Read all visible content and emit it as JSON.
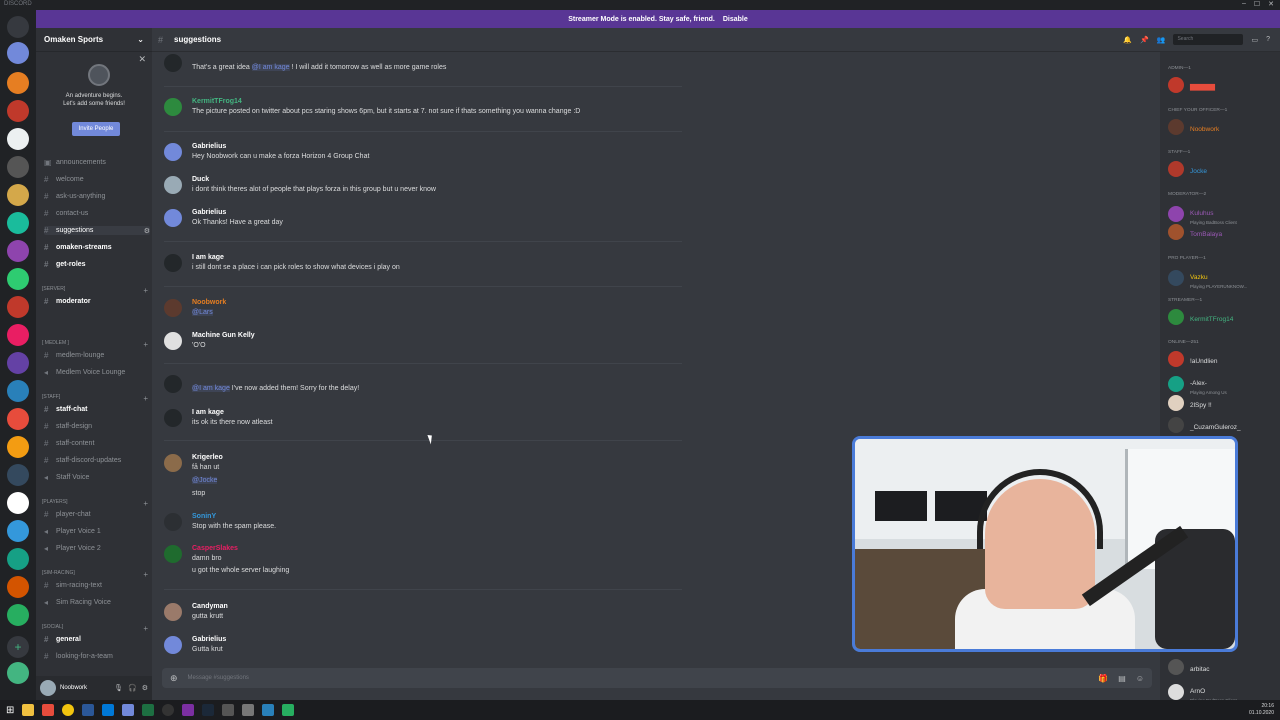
{
  "window": {
    "app_name": "DISCORD",
    "controls": [
      "–",
      "☐",
      "✕"
    ]
  },
  "banner": {
    "text": "Streamer Mode is enabled. Stay safe, friend.",
    "action": "Disable"
  },
  "server": {
    "name": "Omaken Sports",
    "invite": {
      "line1": "An adventure begins.",
      "line2": "Let's add some friends!",
      "button": "Invite People"
    }
  },
  "channel_list": {
    "channels": [
      {
        "label": "announcements"
      },
      {
        "label": "welcome"
      },
      {
        "label": "ask-us-anything"
      },
      {
        "label": "contact-us"
      },
      {
        "label": "suggestions"
      },
      {
        "label": "omaken-streams"
      },
      {
        "label": "get-roles"
      }
    ],
    "cat_server": "[SERVER]",
    "moderator": "moderator",
    "cat_medlem": "[ MEDLEM ]",
    "medlem_lounge": "medlem-lounge",
    "medlem_voice": "Medlem Voice Lounge",
    "cat_staff": "[STAFF]",
    "staff": [
      "staff-chat",
      "staff-design",
      "staff-content",
      "staff-discord-updates",
      "Staff Voice"
    ],
    "cat_players": "[PLAYERS]",
    "players": [
      "player-chat",
      "Player Voice 1",
      "Player Voice 2"
    ],
    "cat_sim": "[SIM-RACING]",
    "sim": [
      "sim-racing-text",
      "Sim Racing Voice"
    ],
    "cat_social": "[SOCIAL]",
    "social": [
      "general",
      "looking-for-a-team"
    ]
  },
  "user_panel": {
    "username": "Noobwork"
  },
  "chat": {
    "channel": "suggestions",
    "search_placeholder": "Search",
    "composer_placeholder": "Message #suggestions",
    "messages": [
      {
        "name": "",
        "line": "That's a great idea",
        "mention": "@I am kage",
        "rest": " ! I will add it tomorrow as well as more game roles"
      },
      {
        "name": "KermitTFrog14",
        "line": "The picture posted on twitter about pcs staring shows 6pm, but it starts at 7. not sure if thats something you wanna change :D"
      },
      {
        "name": "Gabrielius",
        "line": "Hey Noobwork can u make a forza Horizon 4 Group Chat"
      },
      {
        "name": "Duck",
        "line": "i dont think theres alot of people that plays forza in this group but u never know"
      },
      {
        "name": "Gabrielius",
        "line": "Ok Thanks! Have a great day"
      },
      {
        "name": "I am kage",
        "line": "i still dont se a place i can pick roles to show what devices i play on"
      },
      {
        "name": "Noobwork",
        "mention": "@Lars"
      },
      {
        "name": "Machine Gun Kelly",
        "line": "'O'O"
      },
      {
        "name": "",
        "mention": "@I am kage",
        "line": " I've now added them! Sorry for the delay!"
      },
      {
        "name": "I am kage",
        "line": "its ok its there now atleast"
      },
      {
        "name": "Krigerleo",
        "line": "få han ut",
        "mention": "@Jocke",
        "line2": "stop"
      },
      {
        "name": "SoninY",
        "line": "Stop with the spam please."
      },
      {
        "name": "CasperSlakes",
        "line": "damn bro",
        "line2": "u got the whole server laughing"
      },
      {
        "name": "Candyman",
        "line": "gutta krutt"
      },
      {
        "name": "Gabrielius",
        "line": "Gutta krut"
      }
    ]
  },
  "members": {
    "roles": [
      "ADMIN—1",
      "CHIEF YOUR OFFICER—1",
      "STAFF—1",
      "MODERATOR—2",
      "PRO PLAYER—1",
      "STREAMER—1",
      "ONLINE—251"
    ],
    "list": [
      {
        "name": "Noobwork",
        "status": ""
      },
      {
        "name": "Jocke",
        "status": ""
      },
      {
        "name": "Kuluhus",
        "status": "Playing BadBoss Client"
      },
      {
        "name": "TomBalaya",
        "status": ""
      },
      {
        "name": "Vazku",
        "status": "Playing PLAYERUNKNOW..."
      },
      {
        "name": "KermitTFrog14",
        "status": ""
      },
      {
        "name": "!aUndlien",
        "status": ""
      },
      {
        "name": "-Alex-",
        "status": "Playing Among Us"
      },
      {
        "name": "2lSpy !!",
        "status": ""
      },
      {
        "name": "_CuzamGuleroz_",
        "status": ""
      },
      {
        "name": "arbitac",
        "status": ""
      },
      {
        "name": "ArnO",
        "status": "Playing BadBoss Client"
      }
    ]
  },
  "taskbar": {
    "time": "20:16",
    "date": "01.10.2020"
  },
  "colors": {
    "blurple": "#7289da",
    "banner": "#593695",
    "webcam_border": "#4a7bd8"
  }
}
